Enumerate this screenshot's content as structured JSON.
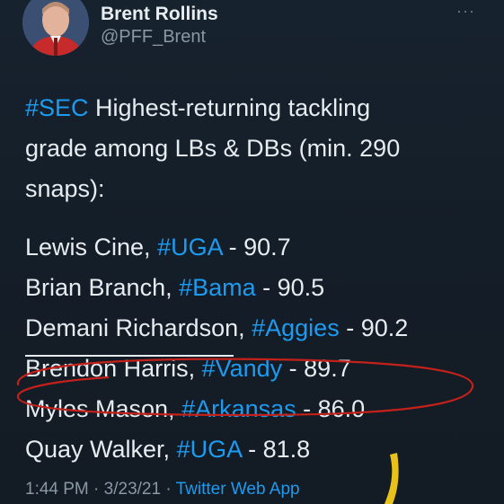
{
  "author": {
    "name": "Brent Rollins",
    "handle": "@PFF_Brent"
  },
  "more_label": "···",
  "intro": {
    "hashtag": "#SEC",
    "text_1": " Highest-returning tackling",
    "text_2": "grade among LBs & DBs (min. 290",
    "text_3": "snaps):"
  },
  "players": [
    {
      "name": "Lewis Cine, ",
      "team": "#UGA",
      "grade": " - 90.7"
    },
    {
      "name": "Brian Branch, ",
      "team": "#Bama",
      "grade": " - 90.5"
    },
    {
      "name": "Demani Richardson, ",
      "team": "#Aggies",
      "grade": " - 90.2"
    },
    {
      "name": "Brendon Harris, ",
      "team": "#Vandy",
      "grade": " - 89.7"
    },
    {
      "name": "Myles Mason, ",
      "team": "#Arkansas",
      "grade": " - 86.0"
    },
    {
      "name": "Quay Walker, ",
      "team": "#UGA",
      "grade": " - 81.8"
    }
  ],
  "meta": {
    "time": "1:44 PM",
    "sep_1": " · ",
    "date": "3/23/21",
    "sep_2": " · ",
    "app": "Twitter Web App"
  },
  "colors": {
    "background": "#15202b",
    "hashtag": "#1d9bf0",
    "annotation_circle": "#c4211b",
    "annotation_marker": "#e8c21a"
  }
}
